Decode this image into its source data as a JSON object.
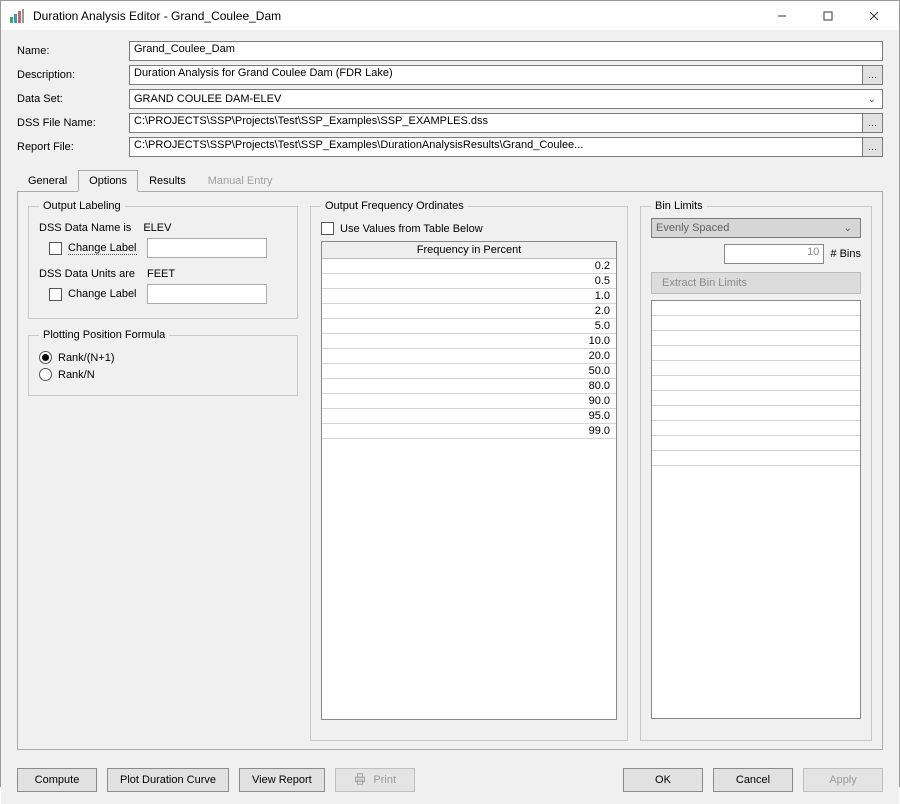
{
  "window": {
    "title": "Duration Analysis Editor - Grand_Coulee_Dam"
  },
  "form": {
    "name_label": "Name:",
    "name_value": "Grand_Coulee_Dam",
    "description_label": "Description:",
    "description_value": "Duration Analysis for Grand Coulee Dam (FDR Lake)",
    "dataset_label": "Data Set:",
    "dataset_value": "GRAND COULEE DAM-ELEV",
    "dssfile_label": "DSS File Name:",
    "dssfile_value": "C:\\PROJECTS\\SSP\\Projects\\Test\\SSP_Examples\\SSP_EXAMPLES.dss",
    "reportfile_label": "Report File:",
    "reportfile_value": "C:\\PROJECTS\\SSP\\Projects\\Test\\SSP_Examples\\DurationAnalysisResults\\Grand_Coulee..."
  },
  "tabs": {
    "general": "General",
    "options": "Options",
    "results": "Results",
    "manual": "Manual Entry"
  },
  "output_labeling": {
    "legend": "Output Labeling",
    "dss_name_label": "DSS Data Name is",
    "dss_name_value": "ELEV",
    "change_label": "Change Label",
    "dss_units_label": "DSS Data Units are",
    "dss_units_value": "FEET"
  },
  "plotting": {
    "legend": "Plotting Position Formula",
    "rank_n1": "Rank/(N+1)",
    "rank_n": "Rank/N"
  },
  "freq": {
    "legend": "Output Frequency Ordinates",
    "use_values": "Use Values from Table Below",
    "header": "Frequency in Percent",
    "rows": [
      "0.2",
      "0.5",
      "1.0",
      "2.0",
      "5.0",
      "10.0",
      "20.0",
      "50.0",
      "80.0",
      "90.0",
      "95.0",
      "99.0"
    ]
  },
  "bins": {
    "legend": "Bin Limits",
    "mode": "Evenly Spaced",
    "count": "10",
    "count_label": "# Bins",
    "extract": "Extract Bin Limits"
  },
  "footer": {
    "compute": "Compute",
    "plot": "Plot Duration Curve",
    "view": "View Report",
    "print": "Print",
    "ok": "OK",
    "cancel": "Cancel",
    "apply": "Apply"
  }
}
